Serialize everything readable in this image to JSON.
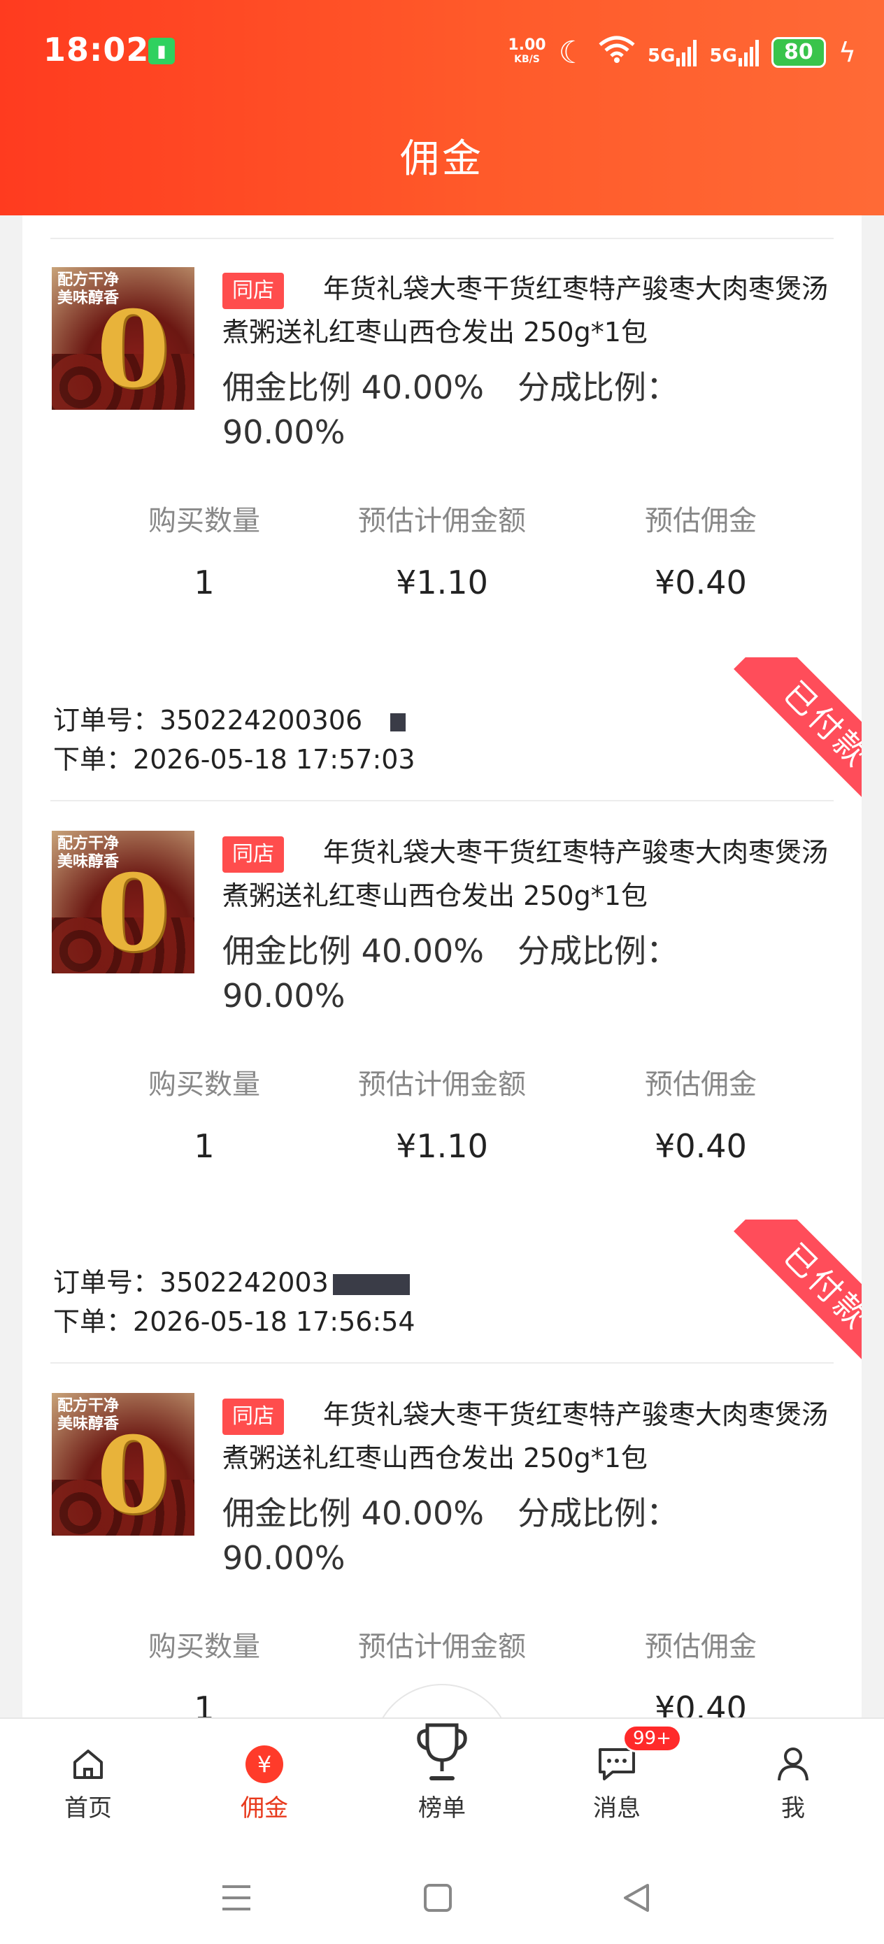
{
  "status_bar": {
    "time": "18:02",
    "net_speed": "1.00",
    "net_unit": "KB/S",
    "signal1": "5G",
    "signal2": "5G",
    "battery": "80"
  },
  "header": {
    "title": "佣金"
  },
  "orders": [
    {
      "shop_tag": "同店",
      "title": "年货礼袋大枣干货红枣特产骏枣大肉枣煲汤煮粥送礼红枣山西仓发出 250g*1包",
      "ratio_commission": "佣金比例 40.00%",
      "ratio_share": "分成比例：90.00%",
      "labels": [
        "购买数量",
        "预估计佣金额",
        "预估佣金"
      ],
      "values": [
        "1",
        "¥1.10",
        "¥0.40"
      ]
    },
    {
      "status": "已付款",
      "order_no_label": "订单号：",
      "order_no": "350224200306",
      "time_label": "下单：",
      "time": "2026-05-18 17:57:03",
      "shop_tag": "同店",
      "title": "年货礼袋大枣干货红枣特产骏枣大肉枣煲汤煮粥送礼红枣山西仓发出 250g*1包",
      "ratio_commission": "佣金比例 40.00%",
      "ratio_share": "分成比例：90.00%",
      "labels": [
        "购买数量",
        "预估计佣金额",
        "预估佣金"
      ],
      "values": [
        "1",
        "¥1.10",
        "¥0.40"
      ]
    },
    {
      "status": "已付款",
      "order_no_label": "订单号：",
      "order_no": "3502242003",
      "time_label": "下单：",
      "time": "2026-05-18 17:56:54",
      "shop_tag": "同店",
      "title": "年货礼袋大枣干货红枣特产骏枣大肉枣煲汤煮粥送礼红枣山西仓发出 250g*1包",
      "ratio_commission": "佣金比例 40.00%",
      "ratio_share": "分成比例：90.00%",
      "labels": [
        "购买数量",
        "预估计佣金额",
        "预估佣金"
      ],
      "values": [
        "1",
        "",
        "¥0.40"
      ]
    }
  ],
  "thumb": {
    "line1": "配方干净",
    "line2": "美味醇香",
    "digit": "0"
  },
  "bottom_nav": {
    "items": [
      "首页",
      "佣金",
      "榜单",
      "消息",
      "我"
    ],
    "message_badge": "99+"
  },
  "colors": {
    "primary": "#ff3b1f",
    "ribbon": "#ff4d5a",
    "active": "#e8391c"
  }
}
